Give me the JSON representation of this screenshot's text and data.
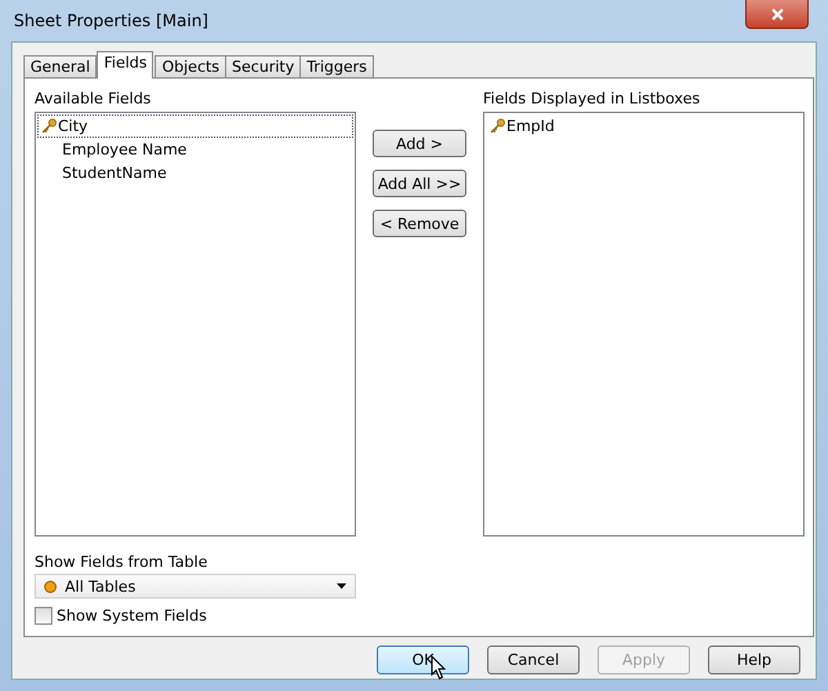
{
  "window": {
    "title": "Sheet Properties [Main]"
  },
  "tabs": [
    {
      "label": "General",
      "selected": false
    },
    {
      "label": "Fields",
      "selected": true
    },
    {
      "label": "Objects",
      "selected": false
    },
    {
      "label": "Security",
      "selected": false
    },
    {
      "label": "Triggers",
      "selected": false
    }
  ],
  "available_fields": {
    "label": "Available Fields",
    "items": [
      {
        "text": "City",
        "kind": "key",
        "focused": true
      },
      {
        "text": "Employee Name",
        "kind": "plain",
        "focused": false
      },
      {
        "text": "StudentName",
        "kind": "plain",
        "focused": false
      }
    ]
  },
  "transfer_buttons": [
    "Add >",
    "Add All >>",
    "< Remove"
  ],
  "displayed_fields": {
    "label": "Fields Displayed in Listboxes",
    "items": [
      {
        "text": "EmpId",
        "kind": "key",
        "focused": false
      }
    ]
  },
  "table_filter": {
    "label": "Show Fields from Table",
    "value": "All Tables"
  },
  "show_system_fields": {
    "label": "Show System Fields",
    "checked": false
  },
  "buttons": [
    {
      "label": "OK",
      "disabled": false,
      "default": true
    },
    {
      "label": "Cancel",
      "disabled": false,
      "default": false
    },
    {
      "label": "Apply",
      "disabled": true,
      "default": false
    },
    {
      "label": "Help",
      "disabled": false,
      "default": false
    }
  ]
}
